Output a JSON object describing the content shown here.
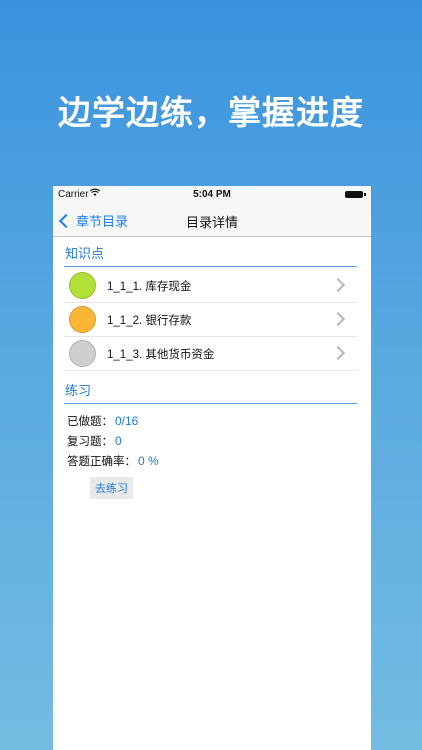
{
  "promo": {
    "headline": "边学边练，掌握进度"
  },
  "status_bar": {
    "carrier": "Carrier",
    "time": "5:04 PM"
  },
  "nav": {
    "back_label": "章节目录",
    "title": "目录详情"
  },
  "knowledge": {
    "header": "知识点",
    "items": [
      {
        "label": "1_1_1. 库存现金",
        "color": "#b3e036"
      },
      {
        "label": "1_1_2. 银行存款",
        "color": "#fbb635"
      },
      {
        "label": "1_1_3. 其他货币资金",
        "color": "#cfcfcf"
      }
    ]
  },
  "practice": {
    "header": "练习",
    "done_label": "已做题：",
    "done_value": "0/16",
    "review_label": "复习题：",
    "review_value": "0",
    "accuracy_label": "答题正确率：",
    "accuracy_value": "0 %",
    "go_button": "去练习"
  },
  "colors": {
    "accent": "#2379d6",
    "nav_blue": "#1a7ef5",
    "promo_bg_top": "#3a93de",
    "promo_bg_bottom": "#73bde2"
  }
}
